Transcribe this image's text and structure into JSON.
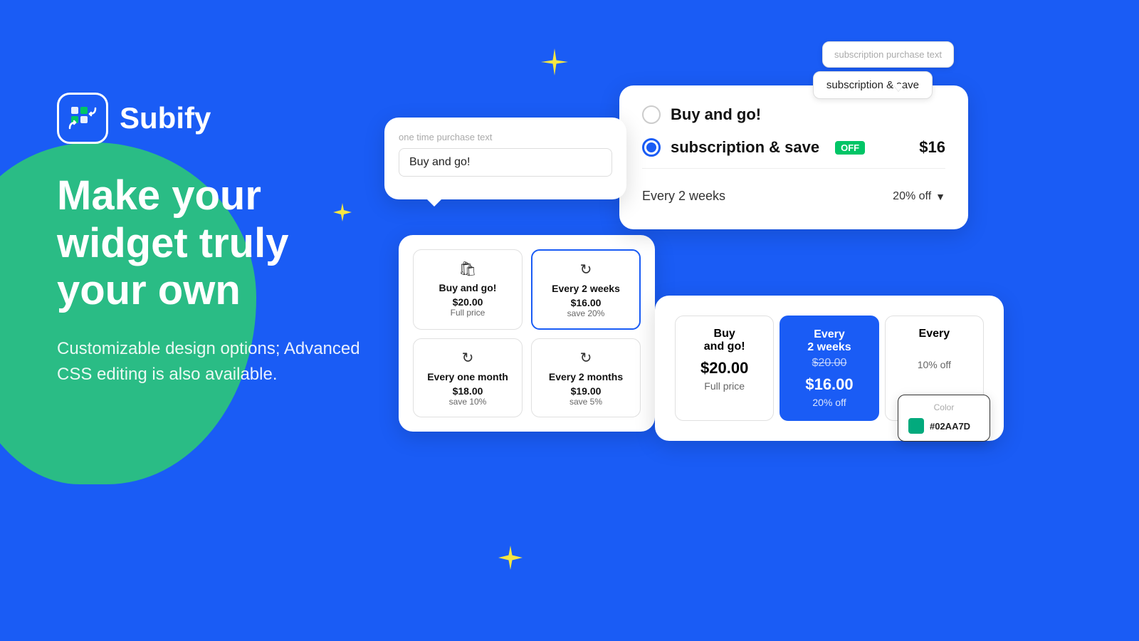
{
  "background_color": "#1a5cf5",
  "logo": {
    "text": "Subify"
  },
  "heading": {
    "line1": "Make your",
    "line2": "widget truly",
    "line3": "your own"
  },
  "subtext": "Customizable design options; Advanced CSS editing is also available.",
  "widget1": {
    "label": "one time purchase text",
    "input_value": "Buy and go!"
  },
  "widget2": {
    "options": [
      {
        "icon": "🛍",
        "title": "Buy and go!",
        "price": "$20.00",
        "savings": "Full price"
      },
      {
        "icon": "↻",
        "title": "Every 2 weeks",
        "price": "$16.00",
        "savings": "save 20%",
        "active": true
      },
      {
        "icon": "↻",
        "title": "Every one month",
        "price": "$18.00",
        "savings": "save 10%"
      },
      {
        "icon": "↻",
        "title": "Every 2 months",
        "price": "$19.00",
        "savings": "save 5%"
      }
    ]
  },
  "widget3": {
    "sub_purchase_label": "subscription purchase text",
    "save_box_text": "subscription & save",
    "options": [
      {
        "label": "Buy and go!",
        "selected": false
      },
      {
        "label": "subscription & save",
        "off_badge": "OFF",
        "price": "$16",
        "selected": true
      }
    ],
    "frequency": {
      "label": "Every 2 weeks",
      "discount": "20% off"
    }
  },
  "widget4": {
    "options": [
      {
        "title": "Buy and go!",
        "price": "$20.00",
        "original": "",
        "discount": "Full price",
        "active": false
      },
      {
        "title": "Every 2 weeks",
        "price": "$16.00",
        "original": "$20.00",
        "discount": "20% off",
        "active": true
      },
      {
        "title": "Every",
        "price": "",
        "original": "",
        "discount": "10% off",
        "active": false
      }
    ]
  },
  "color_popup": {
    "label": "Color",
    "value": "#02AA7D",
    "color_hex": "#02AA7D"
  }
}
